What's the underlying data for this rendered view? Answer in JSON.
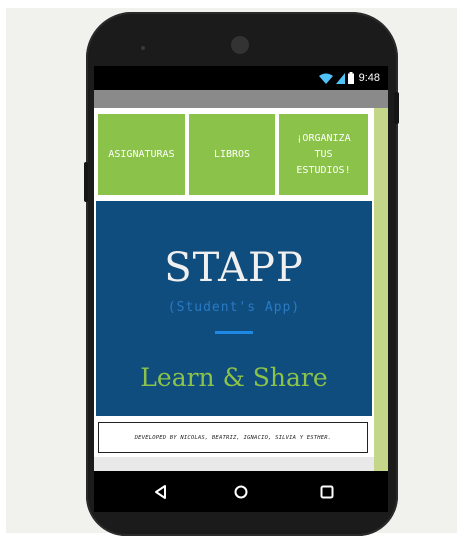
{
  "status_bar": {
    "time": "9:48",
    "icons": [
      "wifi-icon",
      "signal-icon",
      "battery-icon"
    ]
  },
  "menu_tiles": [
    {
      "label": "ASIGNATURAS"
    },
    {
      "label": "LIBROS"
    },
    {
      "label": "¡ORGANIZA\nTUS\nESTUDIOS!"
    }
  ],
  "hero": {
    "title": "STAPP",
    "subtitle": "(Student's App)",
    "tagline": "Learn & Share"
  },
  "footer": {
    "credit": "DEVELOPED BY NICOLAS, BEATRIZ, IGNACIO, SILVIA Y ESTHER."
  },
  "nav_bar": {
    "buttons": [
      "back-icon",
      "home-icon",
      "recents-icon"
    ]
  },
  "colors": {
    "tile_green": "#8bc34a",
    "hero_blue": "#0f4d7e",
    "accent_blue": "#1e88e5",
    "tagline_green": "#8bc34a",
    "device_body": "#1b1b1b"
  }
}
